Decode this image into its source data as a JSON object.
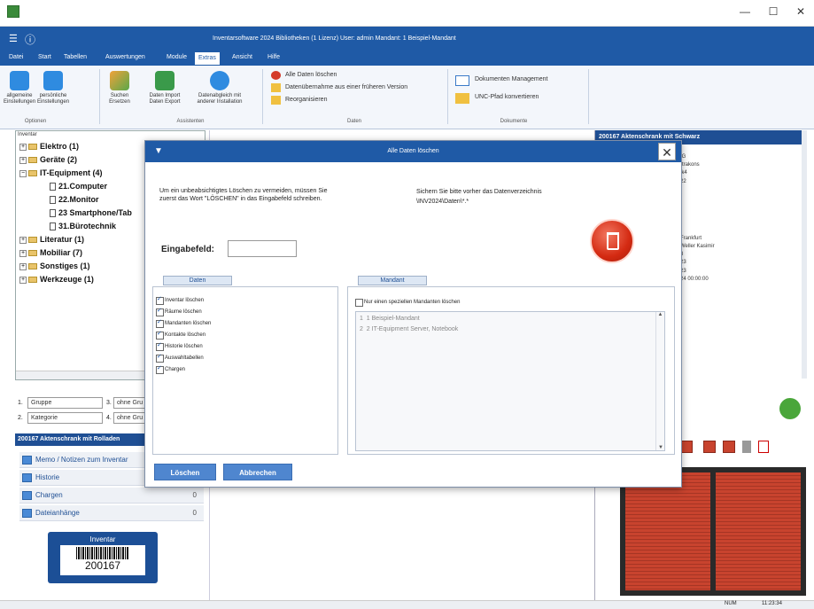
{
  "window": {
    "min": "—",
    "max": "☐",
    "close": "✕"
  },
  "appheader": {
    "menu_glyph": "☰",
    "info_glyph": "ⓘ",
    "title": "Inventarsoftware 2024 Bibliotheken (1 Lizenz)    User: admin    Mandant: 1 Beispiel-Mandant"
  },
  "menu": [
    "Datei",
    "Start",
    "Tabellen",
    "Auswertungen",
    "Module",
    "Extras",
    "Ansicht",
    "Hilfe"
  ],
  "ribbon": {
    "buttons": [
      {
        "label": "allgemeine Einstellungen",
        "icon": "gear-icon"
      },
      {
        "label": "persönliche Einstellungen",
        "icon": "gear-user-icon"
      },
      {
        "label": "Suchen Ersetzen",
        "icon": "search-replace-icon"
      },
      {
        "label": "Daten Import Daten Export",
        "icon": "import-export-icon"
      },
      {
        "label": "Datenabgleich mit anderer Installation",
        "icon": "sync-icon"
      }
    ],
    "groups": [
      "Optionen",
      "Assistenten",
      "Daten",
      "Dokumente"
    ],
    "daten_items": [
      "Alle Daten löschen",
      "Datenübernahme aus einer früheren Version",
      "Reorganisieren"
    ],
    "dokumente_items": [
      "Dokumenten Management",
      "UNC-Pfad konvertieren"
    ]
  },
  "tree": {
    "header": "Inventar",
    "items": [
      {
        "label": "Elektro (1)",
        "type": "folder",
        "level": 0
      },
      {
        "label": "Geräte (2)",
        "type": "folder",
        "level": 0
      },
      {
        "label": "IT-Equipment (4)",
        "type": "folder",
        "level": 0
      },
      {
        "label": "21.Computer",
        "type": "doc",
        "level": 1
      },
      {
        "label": "22.Monitor",
        "type": "doc",
        "level": 1
      },
      {
        "label": "23 Smartphone/Tab",
        "type": "doc",
        "level": 1
      },
      {
        "label": "31.Bürotechnik",
        "type": "doc",
        "level": 1
      },
      {
        "label": "Literatur (1)",
        "type": "folder",
        "level": 0
      },
      {
        "label": "Mobiliar (7)",
        "type": "folder",
        "level": 0
      },
      {
        "label": "Sonstiges (1)",
        "type": "folder",
        "level": 0
      },
      {
        "label": "Werkzeuge (1)",
        "type": "folder",
        "level": 0
      }
    ]
  },
  "grouping": {
    "row1_num": "1.",
    "row1_val": "Gruppe",
    "row1_num2": "3.",
    "row1_val2": "ohne Gru",
    "row2_num": "2.",
    "row2_val": "Kategorie",
    "row2_num2": "4.",
    "row2_val2": "ohne Gru"
  },
  "detail": {
    "title": "200167 Aktenschrank mit Rolladen",
    "sections": [
      {
        "label": "Memo / Notizen zum Inventar",
        "count": ""
      },
      {
        "label": "Historie",
        "count": ""
      },
      {
        "label": "Chargen",
        "count": "0"
      },
      {
        "label": "Dateianhänge",
        "count": "0"
      }
    ],
    "barcode_label": "Inventar",
    "barcode_number": "200167"
  },
  "rightpanel": {
    "header": "200167 Aktenschrank mit Schwarz",
    "lines": [
      "IG",
      "",
      "rtrakons",
      "ik4",
      "",
      "22",
      "",
      "",
      "",
      "",
      "",
      "",
      "Frankfurt",
      "Weller Kasimir",
      "3",
      "23",
      "23",
      "24 00:00:00"
    ]
  },
  "dialog": {
    "title": "Alle Daten löschen",
    "close_glyph": "✕",
    "instruction": "Um ein unbeabsichtigtes Löschen zu vermeiden, müssen Sie zuerst das Wort \"LÖSCHEN\" in das Eingabefeld schreiben.",
    "backup_hint": "Sichern Sie bitte vorher das Datenverzeichnis \\INV2024\\Daten\\*.*",
    "input_label": "Eingabefeld:",
    "input_value": "",
    "tab_daten": "Daten",
    "tab_mandant": "Mandant",
    "checkboxes": [
      {
        "label": "Inventar löschen",
        "checked": true
      },
      {
        "label": "Räume löschen",
        "checked": true
      },
      {
        "label": "Mandanten löschen",
        "checked": true
      },
      {
        "label": "Kontakte löschen",
        "checked": true
      },
      {
        "label": "Historie löschen",
        "checked": true
      },
      {
        "label": "Auswahltabellen",
        "checked": true
      },
      {
        "label": "Chargen",
        "checked": true
      }
    ],
    "mandant_only_label": "Nur einen speziellen Mandanten löschen",
    "mandanten": [
      {
        "num": "1",
        "text": "1 Beispiel-Mandant"
      },
      {
        "num": "2",
        "text": "2 IT-Equipment Server, Notebook"
      }
    ],
    "delete_button": "Löschen",
    "cancel_button": "Abbrechen"
  },
  "status": {
    "mode": "NUM",
    "time": "11:23:34"
  },
  "colors": {
    "brand": "#1f5aa6",
    "danger": "#d42a12"
  }
}
